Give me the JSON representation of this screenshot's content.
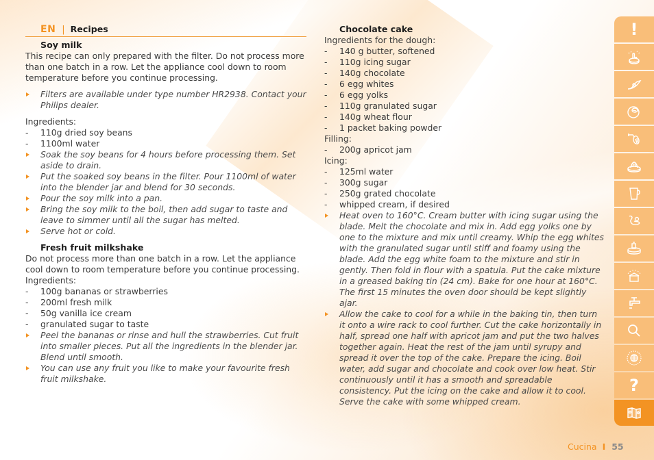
{
  "header": {
    "lang": "EN",
    "title": "Recipes"
  },
  "soy_milk": {
    "title": "Soy milk",
    "intro": "This recipe can only prepared with the filter. Do not process more than one batch in a row. Let the appliance cool down to room temperature before you continue processing.",
    "note": "Filters are available under type number HR2938. Contact your Philips dealer.",
    "ingredients_label": "Ingredients:",
    "ingredients": [
      "110g dried soy beans",
      "1100ml water"
    ],
    "steps": [
      "Soak the soy beans for 4 hours before processing them. Set aside to drain.",
      "Put the soaked soy beans in the filter. Pour 1100ml of water into the blender jar and blend for 30 seconds.",
      "Pour the soy milk into a pan.",
      "Bring the soy milk to the boil, then add sugar to taste and leave to simmer until all the sugar has melted.",
      "Serve hot or cold."
    ]
  },
  "milkshake": {
    "title": "Fresh fruit milkshake",
    "intro": "Do not process more than one batch in a row. Let the appliance cool down to room temperature before you continue processing.",
    "ingredients_label": "Ingredients:",
    "ingredients": [
      "100g bananas or strawberries",
      "200ml fresh milk",
      "50g vanilla ice cream",
      "granulated sugar to taste"
    ],
    "steps": [
      "Peel the bananas or rinse and hull the strawberries. Cut fruit into smaller pieces. Put all the ingredients in the blender jar. Blend until smooth.",
      "You can use any fruit you like to make your favourite fresh fruit milkshake."
    ]
  },
  "chocolate_cake": {
    "title": "Chocolate cake",
    "dough_label": "Ingredients for the dough:",
    "dough": [
      "140 g butter, softened",
      "110g icing sugar",
      "140g chocolate",
      "6 egg whites",
      "6 egg yolks",
      "110g granulated sugar",
      "140g wheat flour",
      "1 packet baking powder"
    ],
    "filling_label": "Filling:",
    "filling": [
      "200g apricot jam"
    ],
    "icing_label": "Icing:",
    "icing": [
      "125ml water",
      "300g sugar",
      "250g grated chocolate",
      "whipped cream, if desired"
    ],
    "steps": [
      "Heat oven to 160°C. Cream butter with icing sugar using the blade. Melt the chocolate and mix in. Add egg yolks one by one to the mixture and mix until creamy. Whip the egg whites with the granulated sugar until stiff and foamy using the blade. Add the egg white foam to the mixture and stir in gently. Then fold in flour with a spatula. Put the cake mixture in a greased baking tin (24 cm). Bake for one hour at 160°C. The first 15 minutes the oven door should be kept slightly ajar.",
      "Allow the cake to cool for a while in the baking tin, then turn it onto a wire rack to cool further. Cut the cake horizontally in half, spread one half with apricot jam and put the two halves together again. Heat the rest of the jam until syrupy and spread it over the top of the cake. Prepare the icing. Boil water, add sugar and chocolate and cook over low heat. Stir continuously until it has a smooth and spreadable consistency. Put the icing on the cake and allow it to cool. Serve the cake with some whipped cream."
    ]
  },
  "tabs": [
    {
      "icon": "important-icon",
      "glyph": "!"
    },
    {
      "icon": "click-and-go-icon"
    },
    {
      "icon": "blade-icon"
    },
    {
      "icon": "disc-icon"
    },
    {
      "icon": "whisk-icon"
    },
    {
      "icon": "citrus-press-icon"
    },
    {
      "icon": "blender-jar-icon"
    },
    {
      "icon": "kneading-tool-icon"
    },
    {
      "icon": "food-processor-icon"
    },
    {
      "icon": "storage-box-icon"
    },
    {
      "icon": "cleaning-tap-icon"
    },
    {
      "icon": "troubleshooting-magnifier-icon"
    },
    {
      "icon": "worldwide-guarantee-icon"
    },
    {
      "icon": "help-icon",
      "glyph": "?"
    },
    {
      "icon": "recipes-map-icon",
      "active": true
    }
  ],
  "footer": {
    "chapter": "Cucina",
    "page": "55"
  },
  "colors": {
    "accent": "#f39323",
    "tab": "#f9be79",
    "text": "#3a3a3a"
  }
}
